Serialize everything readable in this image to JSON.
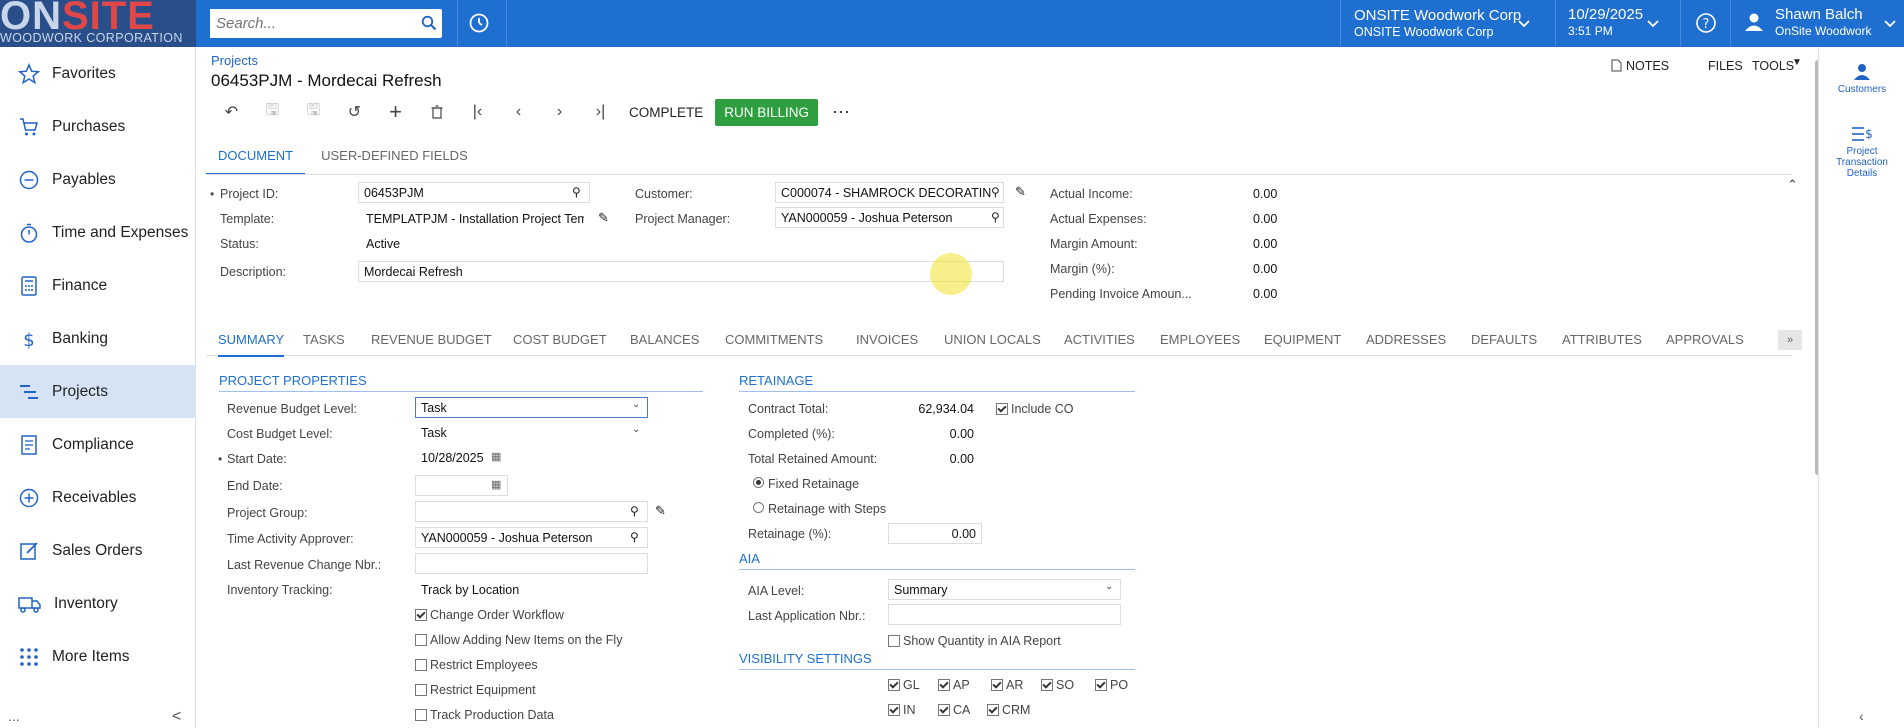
{
  "topbar": {
    "logo_main_a": "ON",
    "logo_main_b": "SITE",
    "logo_sub": "WOODWORK CORPORATION",
    "search_placeholder": "Search...",
    "company": "ONSITE Woodwork Corp",
    "company_sub": "ONSITE Woodwork Corp",
    "date": "10/29/2025",
    "time": "3:51 PM",
    "user_name": "Shawn Balch",
    "user_company": "OnSite Woodwork"
  },
  "sidebar": {
    "items": [
      {
        "label": "Favorites",
        "icon": "star-icon"
      },
      {
        "label": "Purchases",
        "icon": "cart-icon"
      },
      {
        "label": "Payables",
        "icon": "minus-circle-icon"
      },
      {
        "label": "Time and Expenses",
        "icon": "stopwatch-icon"
      },
      {
        "label": "Finance",
        "icon": "calculator-icon"
      },
      {
        "label": "Banking",
        "icon": "dollar-icon"
      },
      {
        "label": "Projects",
        "icon": "gantt-icon"
      },
      {
        "label": "Compliance",
        "icon": "document-icon"
      },
      {
        "label": "Receivables",
        "icon": "plus-circle-icon"
      },
      {
        "label": "Sales Orders",
        "icon": "edit-icon"
      },
      {
        "label": "Inventory",
        "icon": "truck-icon"
      },
      {
        "label": "More Items",
        "icon": "grid-icon"
      }
    ],
    "active": "Projects",
    "footer": "...",
    "collapse": "<"
  },
  "header": {
    "breadcrumb": "Projects",
    "title": "06453PJM - Mordecai Refresh",
    "notes": "NOTES",
    "files": "FILES",
    "tools": "TOOLS"
  },
  "toolbar": {
    "complete": "COMPLETE",
    "run_billing": "RUN BILLING",
    "more": "⋯"
  },
  "doc_tabs": [
    "DOCUMENT",
    "USER-DEFINED FIELDS"
  ],
  "form": {
    "project_id_label": "Project ID:",
    "project_id": "06453PJM",
    "template_label": "Template:",
    "template": "TEMPLATPJM - Installation Project Temp",
    "status_label": "Status:",
    "status": "Active",
    "description_label": "Description:",
    "description": "Mordecai Refresh",
    "customer_label": "Customer:",
    "customer": "C000074 - SHAMROCK DECORATIN",
    "pm_label": "Project Manager:",
    "pm": "YAN000059 - Joshua Peterson",
    "actual_income_label": "Actual Income:",
    "actual_income": "0.00",
    "actual_expenses_label": "Actual Expenses:",
    "actual_expenses": "0.00",
    "margin_amount_label": "Margin Amount:",
    "margin_amount": "0.00",
    "margin_pct_label": "Margin (%):",
    "margin_pct": "0.00",
    "pending_label": "Pending Invoice Amoun...",
    "pending": "0.00"
  },
  "summary_tabs": [
    "SUMMARY",
    "TASKS",
    "REVENUE BUDGET",
    "COST BUDGET",
    "BALANCES",
    "COMMITMENTS",
    "INVOICES",
    "UNION LOCALS",
    "ACTIVITIES",
    "EMPLOYEES",
    "EQUIPMENT",
    "ADDRESSES",
    "DEFAULTS",
    "ATTRIBUTES",
    "APPROVALS"
  ],
  "props": {
    "section": "PROJECT PROPERTIES",
    "rev_budget_label": "Revenue Budget Level:",
    "rev_budget": "Task",
    "cost_budget_label": "Cost Budget Level:",
    "cost_budget": "Task",
    "start_label": "Start Date:",
    "start": "10/28/2025",
    "end_label": "End Date:",
    "end": "",
    "group_label": "Project Group:",
    "group": "",
    "approver_label": "Time Activity Approver:",
    "approver": "YAN000059 - Joshua Peterson",
    "last_rev_label": "Last Revenue Change Nbr.:",
    "last_rev": "",
    "inv_label": "Inventory Tracking:",
    "inv": "Track by Location",
    "cb_change_order": "Change Order Workflow",
    "cb_allow_items": "Allow Adding New Items on the Fly",
    "cb_restrict_emp": "Restrict Employees",
    "cb_restrict_eq": "Restrict Equipment",
    "cb_track_prod": "Track Production Data"
  },
  "retainage": {
    "section": "RETAINAGE",
    "contract_total_label": "Contract Total:",
    "contract_total": "62,934.04",
    "include_co": "Include CO",
    "completed_label": "Completed (%):",
    "completed": "0.00",
    "retained_label": "Total Retained Amount:",
    "retained": "0.00",
    "fixed": "Fixed Retainage",
    "steps": "Retainage with Steps",
    "pct_label": "Retainage (%):",
    "pct": "0.00"
  },
  "aia": {
    "section": "AIA",
    "level_label": "AIA Level:",
    "level": "Summary",
    "last_app_label": "Last Application Nbr.:",
    "last_app": "",
    "show_qty": "Show Quantity in AIA Report"
  },
  "visibility": {
    "section": "VISIBILITY SETTINGS",
    "items": [
      "GL",
      "AP",
      "AR",
      "SO",
      "PO",
      "IN",
      "CA",
      "CRM"
    ]
  },
  "right_panel": {
    "customers": "Customers",
    "ptd": "Project Transaction Details"
  }
}
